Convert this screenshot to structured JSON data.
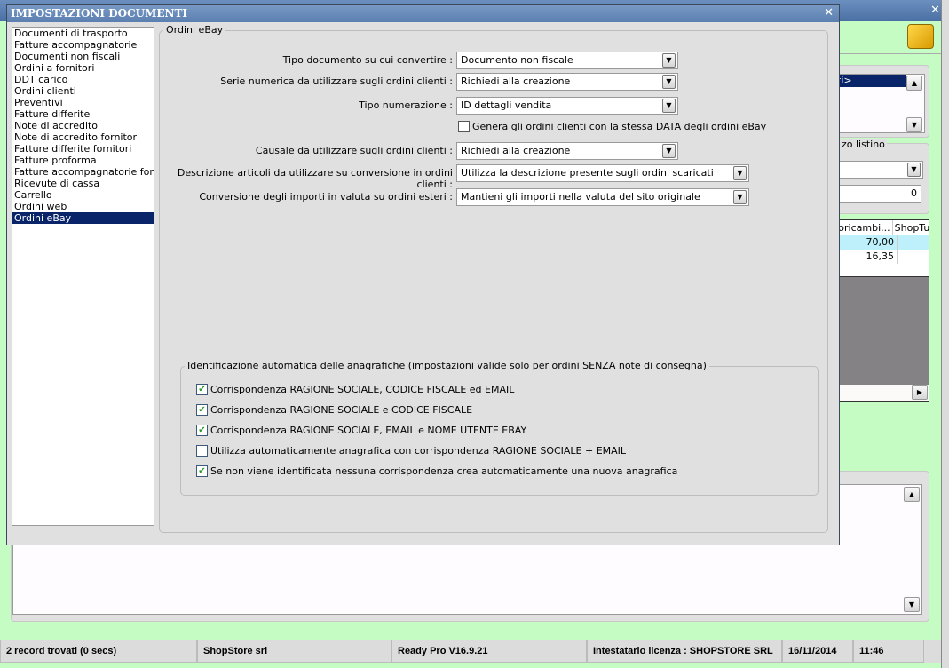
{
  "dialog": {
    "title": "IMPOSTAZIONI DOCUMENTI",
    "categories": [
      "Documenti di trasporto",
      "Fatture accompagnatorie",
      "Documenti non fiscali",
      "Ordini a fornitori",
      "DDT carico",
      "Ordini clienti",
      "Preventivi",
      "Fatture differite",
      "Note di accredito",
      "Note di accredito fornitori",
      "Fatture differite fornitori",
      "Fatture proforma",
      "Fatture accompagnatorie fornito",
      "Ricevute di cassa",
      "Carrello",
      "Ordini web",
      "Ordini eBay"
    ],
    "selected_category": "Ordini eBay",
    "group_title": "Ordini eBay",
    "fields": [
      {
        "label": "Tipo documento su cui convertire :",
        "value": "Documento non fiscale"
      },
      {
        "label": "Serie numerica da utilizzare sugli ordini clienti :",
        "value": "Richiedi alla creazione"
      },
      {
        "label": "Tipo numerazione :",
        "value": "ID dettagli vendita"
      },
      {
        "label": "Causale da utilizzare sugli ordini clienti :",
        "value": "Richiedi alla creazione"
      },
      {
        "label": "Descrizione articoli da utilizzare su conversione in ordini clienti :",
        "value": "Utilizza la descrizione presente sugli ordini scaricati"
      },
      {
        "label": "Conversione degli importi in valuta su ordini esteri :",
        "value": "Mantieni gli importi nella valuta del sito originale"
      }
    ],
    "same_date_checkbox": {
      "label": "Genera gli ordini clienti con la stessa DATA degli ordini eBay",
      "checked": false
    },
    "ident_group_title": "Identificazione automatica delle anagrafiche (impostazioni valide solo per ordini SENZA note di consegna)",
    "ident_options": [
      {
        "label": "Corrispondenza RAGIONE SOCIALE, CODICE FISCALE ed EMAIL",
        "checked": true
      },
      {
        "label": "Corrispondenza RAGIONE SOCIALE e CODICE FISCALE",
        "checked": true
      },
      {
        "label": "Corrispondenza RAGIONE SOCIALE, EMAIL e NOME UTENTE EBAY",
        "checked": true
      },
      {
        "label": "Utilizza automaticamente anagrafica con corrispondenza RAGIONE SOCIALE + EMAIL",
        "checked": false
      },
      {
        "label": "Se non viene identificata nessuna corrispondenza crea automaticamente una nuova anagrafica",
        "checked": true
      }
    ]
  },
  "background": {
    "list_selected": "ti>",
    "price_label": "zo listino",
    "price_value": "0",
    "table": {
      "headers": [
        "utoricambi...",
        "ShopTu"
      ],
      "rows": [
        [
          "70,00",
          ""
        ],
        [
          "16,35",
          ""
        ]
      ]
    }
  },
  "statusbar": [
    "2 record trovati (0 secs)",
    "ShopStore srl",
    "Ready Pro V16.9.21",
    "Intestatario licenza : SHOPSTORE SRL",
    "16/11/2014",
    "11:46"
  ],
  "colors": {
    "selection": "#0a246a",
    "background": "#c4fcc4",
    "titlebar": "#5b7fb0"
  }
}
